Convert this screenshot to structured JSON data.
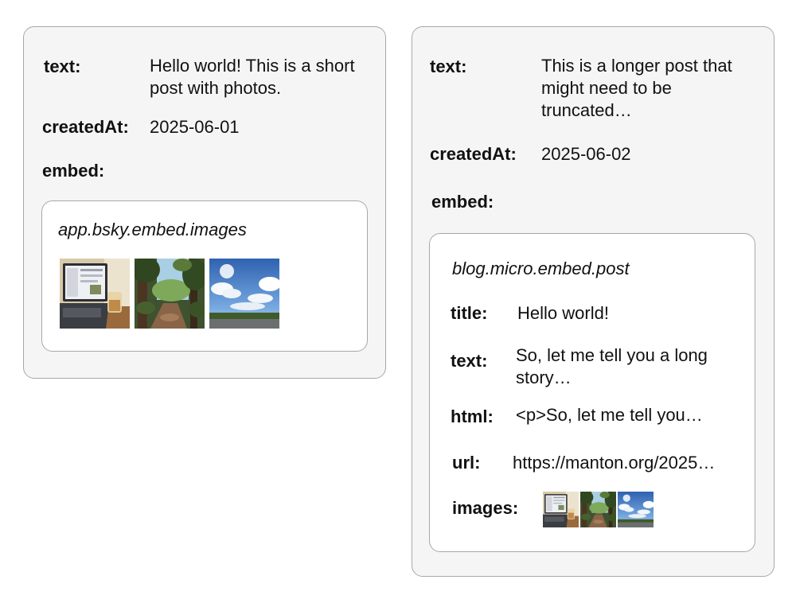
{
  "left_post": {
    "text_label": "text:",
    "text_value": "Hello world! This is a short post with photos.",
    "created_label": "createdAt:",
    "created_value": "2025-06-01",
    "embed_label": "embed:",
    "embed": {
      "type": "app.bsky.embed.images",
      "images": [
        "laptop-desk-photo",
        "forest-path-photo",
        "sky-clouds-photo"
      ]
    }
  },
  "right_post": {
    "text_label": "text:",
    "text_value": "This is a longer post that might need to be truncated…",
    "created_label": "createdAt:",
    "created_value": "2025-06-02",
    "embed_label": "embed:",
    "embed": {
      "type": "blog.micro.embed.post",
      "title_label": "title:",
      "title_value": "Hello world!",
      "text_label": "text:",
      "text_value": "So, let me tell you a long story…",
      "html_label": "html:",
      "html_value": "<p>So, let me tell you…",
      "url_label": "url:",
      "url_value": "https://manton.org/2025…",
      "images_label": "images:",
      "images": [
        "laptop-desk-photo",
        "forest-path-photo",
        "sky-clouds-photo"
      ]
    }
  },
  "colors": {
    "card_background": "#f5f5f5",
    "card_border": "#a8a8a8",
    "embed_background": "#ffffff",
    "text": "#111111"
  }
}
